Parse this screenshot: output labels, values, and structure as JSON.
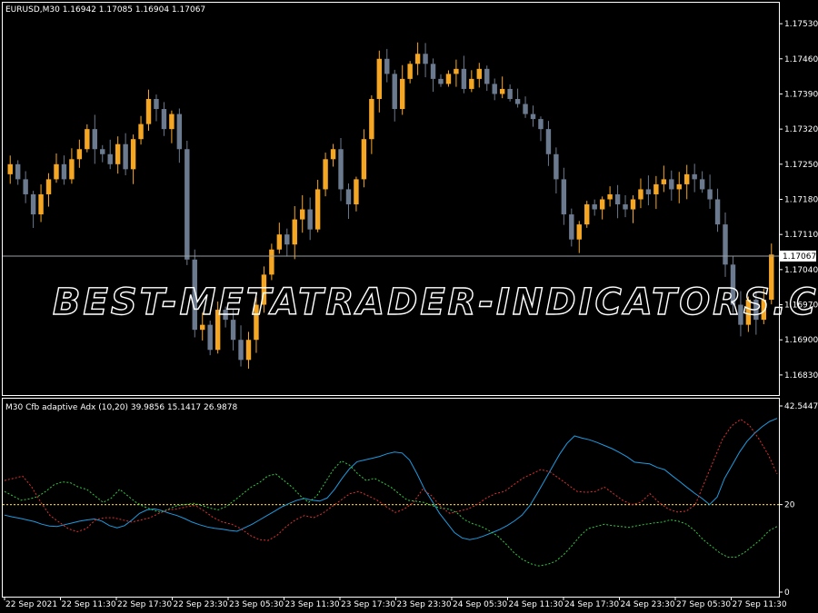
{
  "main_chart": {
    "header_text": "EURUSD,M30  1.16942 1.17085 1.16904 1.17067",
    "current_price_label": "1.17067",
    "current_price": 1.17067,
    "colors": {
      "bull": "#f5a623",
      "bear": "#6b7a8f",
      "green_candle": "#2ecc40",
      "price_line": "#9aa0a6",
      "grid": "#ffffff"
    },
    "watermark": "BEST-METATRADER-INDICATORS.COM"
  },
  "indicator": {
    "header_text": "M30 Cfb adaptive Adx (10,20) 39.9856 15.1417 26.9878",
    "level_label": "20",
    "colors": {
      "adx": "#1e9be0",
      "plus_di": "#2ecc40",
      "minus_di": "#e03030",
      "level": "#e8c21a"
    }
  },
  "chart_data": [
    {
      "type": "candlestick",
      "title": "EURUSD,M30",
      "ylim": [
        1.1679,
        1.1757
      ],
      "y_ticks": [
        "1.17530",
        "1.17460",
        "1.17390",
        "1.17320",
        "1.17250",
        "1.17180",
        "1.17110",
        "1.17040",
        "1.16970",
        "1.16900",
        "1.16830"
      ],
      "x_ticks": [
        "22 Sep 2021",
        "22 Sep 11:30",
        "22 Sep 17:30",
        "22 Sep 23:30",
        "23 Sep 05:30",
        "23 Sep 11:30",
        "23 Sep 17:30",
        "23 Sep 23:30",
        "24 Sep 05:30",
        "24 Sep 11:30",
        "24 Sep 17:30",
        "24 Sep 23:30",
        "27 Sep 05:30",
        "27 Sep 11:30"
      ],
      "close_path": [
        1.1725,
        1.1722,
        1.1719,
        1.1715,
        1.1719,
        1.1722,
        1.1725,
        1.1722,
        1.1726,
        1.1728,
        1.1732,
        1.1728,
        1.1727,
        1.1725,
        1.1729,
        1.1724,
        1.173,
        1.1733,
        1.1738,
        1.1736,
        1.1732,
        1.1735,
        1.1728,
        1.1706,
        1.1692,
        1.1693,
        1.1688,
        1.1696,
        1.1694,
        1.169,
        1.1686,
        1.169,
        1.1697,
        1.1703,
        1.1708,
        1.1711,
        1.1709,
        1.1714,
        1.1716,
        1.1712,
        1.172,
        1.1726,
        1.1728,
        1.172,
        1.1717,
        1.1722,
        1.173,
        1.1738,
        1.1746,
        1.1743,
        1.1736,
        1.1742,
        1.1745,
        1.1747,
        1.1745,
        1.1742,
        1.1741,
        1.1743,
        1.1744,
        1.174,
        1.1742,
        1.1744,
        1.1741,
        1.1739,
        1.174,
        1.1738,
        1.1737,
        1.1735,
        1.1734,
        1.1732,
        1.1727,
        1.1722,
        1.1715,
        1.171,
        1.1713,
        1.1717,
        1.1716,
        1.1718,
        1.1719,
        1.1717,
        1.1716,
        1.1718,
        1.172,
        1.1719,
        1.1721,
        1.1722,
        1.172,
        1.1721,
        1.1723,
        1.1722,
        1.172,
        1.1718,
        1.1713,
        1.1705,
        1.1697,
        1.1693,
        1.1698,
        1.1694,
        1.1698,
        1.1707
      ]
    },
    {
      "type": "line",
      "title": "M30 Cfb adaptive Adx (10,20)",
      "ylim": [
        0,
        42.5447
      ],
      "y_ticks": [
        "42.5447",
        "20",
        "0"
      ],
      "level": 20,
      "series": [
        {
          "values": [
            17.6,
            17.2,
            16.9,
            16.5,
            16.1,
            15.5,
            15.1,
            15.0,
            15.4,
            15.8,
            16.2,
            16.5,
            16.7,
            16.2,
            15.2,
            14.7,
            15.2,
            16.5,
            18.0,
            18.8,
            19.0,
            18.6,
            18.0,
            17.5,
            16.8,
            16.0,
            15.4,
            14.9,
            14.6,
            14.4,
            14.1,
            13.9,
            14.7,
            15.5,
            16.5,
            17.5,
            18.5,
            19.5,
            20.3,
            21.0,
            21.4,
            21.0,
            20.8,
            21.5,
            23.5,
            26.0,
            28.2,
            29.8,
            30.2,
            30.6,
            31.0,
            31.6,
            32.0,
            31.8,
            30.2,
            27.0,
            23.5,
            20.8,
            18.0,
            15.8,
            13.6,
            12.4,
            12.0,
            12.3,
            12.9,
            13.6,
            14.3,
            15.2,
            16.3,
            17.6,
            19.7,
            22.5,
            25.5,
            28.5,
            31.5,
            34.0,
            35.7,
            35.2,
            34.8,
            34.2,
            33.5,
            32.8,
            31.9,
            30.9,
            29.7,
            29.5,
            29.3,
            28.5,
            28.0,
            26.6,
            25.3,
            23.9,
            22.6,
            21.4,
            20.0,
            21.7,
            26.0,
            29.0,
            32.0,
            34.5,
            36.3,
            37.8,
            39.0,
            39.7
          ]
        },
        {
          "values": [
            23.0,
            22.0,
            21.0,
            21.3,
            21.8,
            23.0,
            24.5,
            25.2,
            25.0,
            24.0,
            23.5,
            22.0,
            20.5,
            21.5,
            23.5,
            22.0,
            20.5,
            19.5,
            18.8,
            18.2,
            19.0,
            19.8,
            20.0,
            20.3,
            19.8,
            19.2,
            18.8,
            19.6,
            21.0,
            22.5,
            24.0,
            25.0,
            26.5,
            27.0,
            25.5,
            24.0,
            22.0,
            20.5,
            22.0,
            25.0,
            28.0,
            30.0,
            29.0,
            27.0,
            25.5,
            26.0,
            25.0,
            24.0,
            22.5,
            21.0,
            20.8,
            20.5,
            19.8,
            19.2,
            19.0,
            18.2,
            16.5,
            15.6,
            15.0,
            14.0,
            12.8,
            11.0,
            9.0,
            7.5,
            6.5,
            6.0,
            6.3,
            7.0,
            8.5,
            10.5,
            12.8,
            14.5,
            15.0,
            15.5,
            15.2,
            15.0,
            14.8,
            15.2,
            15.5,
            15.8,
            16.0,
            16.5,
            16.2,
            15.5,
            14.0,
            12.0,
            10.5,
            9.0,
            8.0,
            8.0,
            9.0,
            10.5,
            12.0,
            14.0,
            15.0
          ]
        },
        {
          "values": [
            25.5,
            26.0,
            26.5,
            24.0,
            20.5,
            17.5,
            16.0,
            14.5,
            13.8,
            14.5,
            16.5,
            17.0,
            17.0,
            16.5,
            16.0,
            16.5,
            17.0,
            18.0,
            18.8,
            19.0,
            19.5,
            19.8,
            18.5,
            17.0,
            16.0,
            15.5,
            14.5,
            13.0,
            12.0,
            11.8,
            13.0,
            15.0,
            16.5,
            17.5,
            17.0,
            18.0,
            19.5,
            21.0,
            22.5,
            23.0,
            22.0,
            21.0,
            19.5,
            18.2,
            19.0,
            20.5,
            23.5,
            22.0,
            19.5,
            18.0,
            18.5,
            19.0,
            20.0,
            21.5,
            22.5,
            23.0,
            24.5,
            26.0,
            27.0,
            28.0,
            27.5,
            26.0,
            24.5,
            23.0,
            22.8,
            23.0,
            24.0,
            22.5,
            21.0,
            20.0,
            20.5,
            22.5,
            20.5,
            19.0,
            18.3,
            18.5,
            20.0,
            25.0,
            30.0,
            35.0,
            38.0,
            39.5,
            38.0,
            35.0,
            31.5,
            27.0
          ]
        }
      ]
    }
  ]
}
